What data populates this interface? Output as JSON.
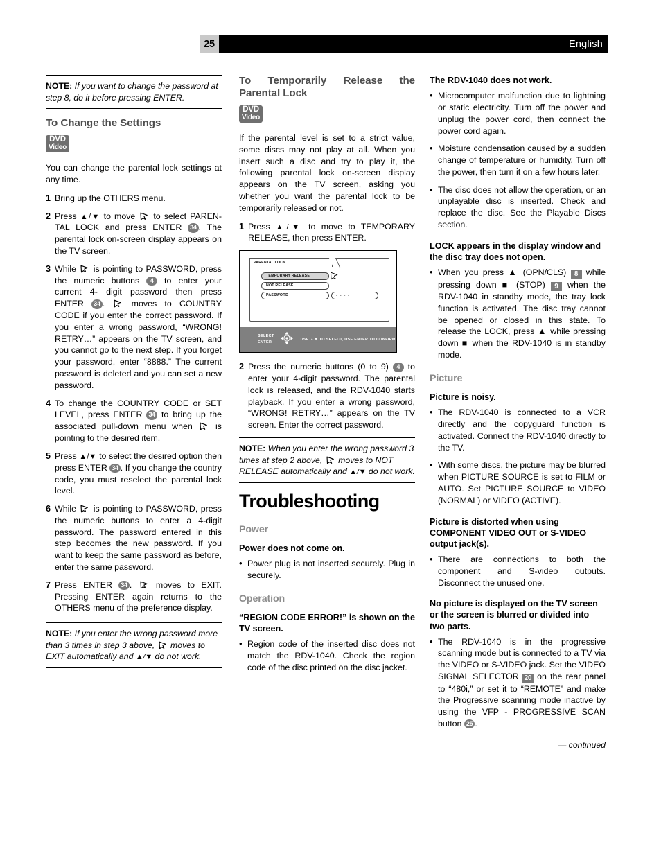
{
  "header": {
    "page_number": "25",
    "language": "English"
  },
  "column1": {
    "note_top": {
      "label": "NOTE:",
      "text": " If you want to change the password at step 8, do it before pressing ENTER."
    },
    "section_title": "To Change the Settings",
    "disc_badge": {
      "line1": "DVD",
      "line2": "Video"
    },
    "intro": "You can change the parental lock settings at any time.",
    "steps": [
      {
        "num": "1",
        "parts": [
          {
            "t": "text",
            "v": "Bring up the OTHERS menu."
          }
        ]
      },
      {
        "num": "2",
        "parts": [
          {
            "t": "text",
            "v": "Press "
          },
          {
            "t": "arrows",
            "v": "▲/▼"
          },
          {
            "t": "text",
            "v": " to move "
          },
          {
            "t": "cursor"
          },
          {
            "t": "text",
            "v": " to select PAREN-TAL LOCK and press ENTER "
          },
          {
            "t": "badge-round",
            "v": "34"
          },
          {
            "t": "text",
            "v": ". The parental lock on-screen display appears on the TV screen."
          }
        ]
      },
      {
        "num": "3",
        "parts": [
          {
            "t": "text",
            "v": "While "
          },
          {
            "t": "cursor"
          },
          {
            "t": "text",
            "v": " is pointing to PASSWORD, press the numeric buttons "
          },
          {
            "t": "badge-round",
            "v": "4"
          },
          {
            "t": "text",
            "v": " to enter your current 4- digit password then press ENTER "
          },
          {
            "t": "badge-round",
            "v": "34"
          },
          {
            "t": "text",
            "v": ". "
          },
          {
            "t": "cursor"
          },
          {
            "t": "text",
            "v": " moves to COUNTRY CODE if you enter the correct password. If you enter a wrong password, “WRONG! RETRY…” appears on the TV screen, and you cannot go to the next step. If you forget your password, enter “8888.” The current password is deleted and you can set a new password."
          }
        ]
      },
      {
        "num": "4",
        "parts": [
          {
            "t": "text",
            "v": "To change the COUNTRY CODE or SET LEVEL, press ENTER "
          },
          {
            "t": "badge-round",
            "v": "34"
          },
          {
            "t": "text",
            "v": " to bring up the associated pull-down menu when "
          },
          {
            "t": "cursor"
          },
          {
            "t": "text",
            "v": " is pointing to the desired item."
          }
        ]
      },
      {
        "num": "5",
        "parts": [
          {
            "t": "text",
            "v": "Press "
          },
          {
            "t": "arrows",
            "v": "▲/▼"
          },
          {
            "t": "text",
            "v": " to select the desired option then press ENTER "
          },
          {
            "t": "badge-round",
            "v": "34"
          },
          {
            "t": "text",
            "v": ". If you change the country code, you must reselect the parental lock level."
          }
        ]
      },
      {
        "num": "6",
        "parts": [
          {
            "t": "text",
            "v": "While "
          },
          {
            "t": "cursor"
          },
          {
            "t": "text",
            "v": " is pointing to PASSWORD, press the numeric buttons to enter a 4-digit password. The password entered in this step becomes the new password. If you want to keep the same password as before, enter the same password."
          }
        ]
      },
      {
        "num": "7",
        "parts": [
          {
            "t": "text",
            "v": "Press ENTER "
          },
          {
            "t": "badge-round",
            "v": "34"
          },
          {
            "t": "text",
            "v": ". "
          },
          {
            "t": "cursor"
          },
          {
            "t": "text",
            "v": " moves to EXIT. Pressing ENTER again returns to the OTHERS menu of the preference display."
          }
        ]
      }
    ],
    "note_bottom": {
      "label": "NOTE:",
      "parts": [
        {
          "t": "text",
          "v": " If you enter the wrong password more than 3 times in step 3 above, "
        },
        {
          "t": "cursor"
        },
        {
          "t": "text",
          "v": " moves to EXIT automatically and "
        },
        {
          "t": "arrows",
          "v": "▲/▼"
        },
        {
          "t": "text",
          "v": " do not work."
        }
      ]
    }
  },
  "column2": {
    "section_title": "To Temporarily Release the Parental Lock",
    "disc_badge": {
      "line1": "DVD",
      "line2": "Video"
    },
    "intro": "If the parental level is set to a strict value, some discs may not play at all. When you insert such a disc and try to play it, the following parental lock on-screen display appears on the TV screen, asking you whether you want the parental lock to be temporarily released or not.",
    "step1": {
      "num": "1",
      "parts": [
        {
          "t": "text",
          "v": "Press "
        },
        {
          "t": "arrows",
          "v": "▲/▼"
        },
        {
          "t": "text",
          "v": " to move to TEMPORARY RELEASE, then press ENTER."
        }
      ]
    },
    "osd": {
      "tab_label": "PARENTAL LOCK",
      "items": [
        {
          "label": "TEMPORARY RELEASE",
          "selected": true
        },
        {
          "label": "NOT RELEASE",
          "selected": false
        },
        {
          "label": "PASSWORD",
          "selected": false
        }
      ],
      "password_value": "- - - -",
      "footer_left_line1": "SELECT",
      "footer_left_line2": "ENTER",
      "footer_right": "USE ▲▼ TO SELECT, USE ENTER TO CONFIRM"
    },
    "step2": {
      "num": "2",
      "parts": [
        {
          "t": "text",
          "v": "Press the numeric buttons (0 to 9) "
        },
        {
          "t": "badge-round",
          "v": "4"
        },
        {
          "t": "text",
          "v": " to enter your 4-digit password. The parental lock is released, and the RDV-1040 starts playback. If you enter a wrong password, “WRONG! RETRY…” appears on the TV screen. Enter the correct password."
        }
      ]
    },
    "note": {
      "label": "NOTE:",
      "parts": [
        {
          "t": "text",
          "v": " When you enter the wrong password 3 times at step 2 above, "
        },
        {
          "t": "cursor"
        },
        {
          "t": "text",
          "v": " moves to NOT RELEASE automatically and "
        },
        {
          "t": "arrows",
          "v": "▲/▼"
        },
        {
          "t": "text",
          "v": " do not work."
        }
      ]
    },
    "troubleshooting_title": "Troubleshooting",
    "power": {
      "heading": "Power",
      "problem": "Power does not come on.",
      "bullets": [
        "Power plug is not inserted securely. Plug in securely."
      ]
    },
    "operation": {
      "heading": "Operation",
      "problem": "“REGION CODE ERROR!” is shown on the TV screen.",
      "bullets": [
        "Region code of the inserted disc does not match the RDV-1040. Check the region code of the disc printed on the disc jacket."
      ]
    }
  },
  "column3": {
    "not_work": {
      "problem": "The RDV-1040 does not work.",
      "bullets": [
        "Microcomputer malfunction due to lightning or static electricity. Turn off the power and unplug the power cord, then connect the power cord again.",
        "Moisture condensation caused by a sudden change of temperature or humidity. Turn off the power, then turn it on a few hours later.",
        "The disc does not allow the operation, or an unplayable disc is inserted. Check and replace the disc. See the Playable Discs section."
      ]
    },
    "lock": {
      "problem": "LOCK appears in the display window and the disc tray does not open.",
      "bullet_parts": [
        {
          "t": "text",
          "v": "When you press ▲ (OPN/CLS) "
        },
        {
          "t": "badge-square",
          "v": "8"
        },
        {
          "t": "text",
          "v": " while pressing down ■ (STOP) "
        },
        {
          "t": "badge-square",
          "v": "9"
        },
        {
          "t": "text",
          "v": " when the RDV-1040 in standby mode, the tray lock function is activated. The disc tray cannot be opened or closed in this state. To release the LOCK, press ▲ while pressing down ■ when the RDV-1040 is in standby mode."
        }
      ]
    },
    "picture": {
      "heading": "Picture",
      "noisy": {
        "problem": "Picture is noisy.",
        "bullets": [
          "The RDV-1040 is connected to a VCR directly and the copyguard function is activated. Connect the RDV-1040 directly to the TV.",
          "With some discs, the picture may be blurred when PICTURE SOURCE is set to FILM or AUTO. Set PICTURE SOURCE to VIDEO (NORMAL) or VIDEO (ACTIVE)."
        ]
      },
      "distorted": {
        "problem": "Picture is distorted when using COMPONENT VIDEO OUT or S-VIDEO output jack(s).",
        "bullets": [
          "There are connections to both the component and S-video outputs. Disconnect the unused one."
        ]
      },
      "no_picture": {
        "problem": "No picture is displayed on the TV screen or the screen is blurred or divided into two parts.",
        "bullet_parts": [
          {
            "t": "text",
            "v": "The RDV-1040 is in the progressive scanning mode but  is connected to a TV via the VIDEO or S-VIDEO jack. Set the VIDEO SIGNAL SELECTOR "
          },
          {
            "t": "badge-square",
            "v": "20"
          },
          {
            "t": "text",
            "v": " on the rear panel to “480i,” or set it to “REMOTE” and make the Progressive scanning mode inactive by using the VFP - PROGRESSIVE SCAN button "
          },
          {
            "t": "badge-round",
            "v": "25"
          },
          {
            "t": "text",
            "v": "."
          }
        ]
      }
    },
    "continued": "— continued"
  },
  "colors": {
    "header_bar": "#000000",
    "page_number_bg": "#c9c9c9",
    "badge_gray": "#7a7a7a",
    "section_heading_gray": "#4d4d4d",
    "subsection_heading_gray": "#8c8c8c",
    "osd_footer_gray": "#808080",
    "osd_selected_gray": "#d6d6d6"
  }
}
